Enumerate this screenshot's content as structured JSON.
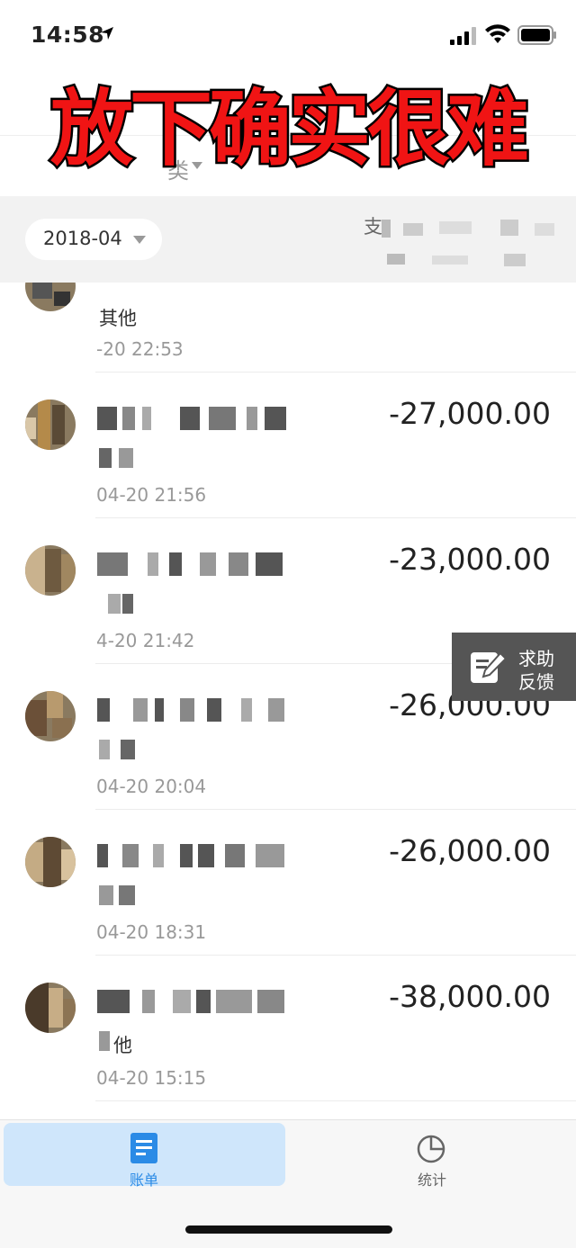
{
  "status": {
    "time": "14:58"
  },
  "overlay": {
    "caption": "放下确实很难"
  },
  "header": {
    "category_stub": "类"
  },
  "filter": {
    "month": "2018-04",
    "summary_label": "支"
  },
  "entries": [
    {
      "sub": "其他",
      "time": "-20  22:53",
      "amount": ""
    },
    {
      "sub": "",
      "time": "04-20  21:56",
      "amount": "-27,000.00"
    },
    {
      "sub": "",
      "time": "4-20  21:42",
      "amount": "-23,000.00"
    },
    {
      "sub": "",
      "time": "04-20  20:04",
      "amount": "-26,000.00"
    },
    {
      "sub": "",
      "time": "04-20  18:31",
      "amount": "-26,000.00"
    },
    {
      "sub": "他",
      "time": "04-20  15:15",
      "amount": "-38,000.00"
    }
  ],
  "help": {
    "line1": "求助",
    "line2": "反馈"
  },
  "tabs": [
    {
      "label": "账单",
      "icon": "bill-icon",
      "active": true,
      "color": "#2b8be6"
    },
    {
      "label": "统计",
      "icon": "pie-chart-icon",
      "active": false,
      "color": "#666666"
    }
  ]
}
